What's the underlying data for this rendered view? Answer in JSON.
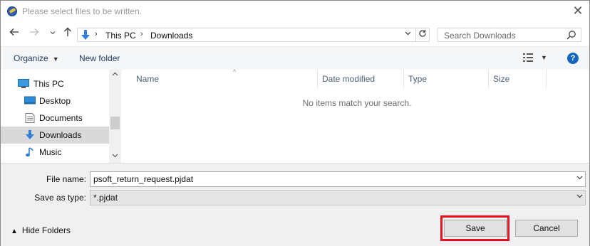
{
  "window": {
    "title": "Please select files to be written.",
    "close_glyph": "✕"
  },
  "nav": {
    "back_icon": "arrow-left-icon",
    "forward_icon": "arrow-right-icon",
    "recent_icon": "chevron-down-icon",
    "up_icon": "arrow-up-icon",
    "breadcrumb": [
      "This PC",
      "Downloads"
    ],
    "refresh_icon": "refresh-icon"
  },
  "search": {
    "placeholder": "Search Downloads"
  },
  "toolbar": {
    "organize_label": "Organize",
    "new_folder_label": "New folder",
    "help_label": "?"
  },
  "sidebar": {
    "items": [
      {
        "label": "This PC",
        "icon": "computer-icon",
        "selected": false
      },
      {
        "label": "Desktop",
        "icon": "desktop-icon",
        "selected": false
      },
      {
        "label": "Documents",
        "icon": "documents-icon",
        "selected": false
      },
      {
        "label": "Downloads",
        "icon": "download-arrow-icon",
        "selected": true
      },
      {
        "label": "Music",
        "icon": "music-note-icon",
        "selected": false
      }
    ]
  },
  "file_list": {
    "columns": [
      "Name",
      "Date modified",
      "Type",
      "Size"
    ],
    "empty_message": "No items match your search."
  },
  "form": {
    "file_name_label": "File name:",
    "file_name_value": "psoft_return_request.pjdat",
    "save_type_label": "Save as type:",
    "save_type_value": "*.pjdat"
  },
  "footer": {
    "hide_folders_label": "Hide Folders",
    "save_label": "Save",
    "cancel_label": "Cancel"
  },
  "colors": {
    "accent": "#1565c0",
    "highlight": "#e8101e",
    "selected_bg": "#d9d9d9"
  }
}
